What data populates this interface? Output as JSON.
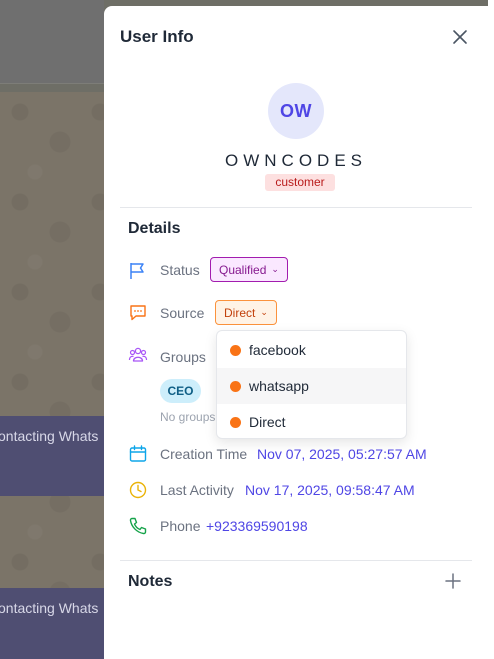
{
  "background": {
    "bubble_text_1": "ontacting Whats",
    "bubble_text_2": "ontacting Whats"
  },
  "panel": {
    "title": "User Info",
    "close_icon": "close-icon"
  },
  "profile": {
    "initials": "OW",
    "name": "OWNCODES",
    "role": "customer"
  },
  "details": {
    "heading": "Details",
    "status": {
      "label": "Status",
      "value": "Qualified",
      "icon": "flag-icon"
    },
    "source": {
      "label": "Source",
      "value": "Direct",
      "icon": "chat-bubble-icon"
    },
    "groups": {
      "label": "Groups",
      "tag": "CEO",
      "empty_text": "No groups",
      "icon": "users-icon"
    },
    "creation_time": {
      "label": "Creation Time",
      "value": "Nov 07, 2025, 05:27:57 AM",
      "icon": "calendar-icon"
    },
    "last_activity": {
      "label": "Last Activity",
      "value": "Nov 17, 2025, 09:58:47 AM",
      "icon": "clock-icon"
    },
    "phone": {
      "label": "Phone",
      "value": "+923369590198",
      "icon": "phone-icon"
    }
  },
  "source_dropdown": {
    "options": [
      "facebook",
      "whatsapp",
      "Direct"
    ],
    "highlighted": "whatsapp"
  },
  "notes": {
    "heading": "Notes",
    "add_icon": "plus-icon"
  },
  "colors": {
    "accent": "#4f46e5",
    "status_purple": "#a21caf",
    "source_orange": "#fb923c",
    "dot_orange": "#f97316",
    "phone_green": "#16a34a",
    "clock_yellow": "#eab308",
    "calendar_blue": "#0ea5e9"
  }
}
